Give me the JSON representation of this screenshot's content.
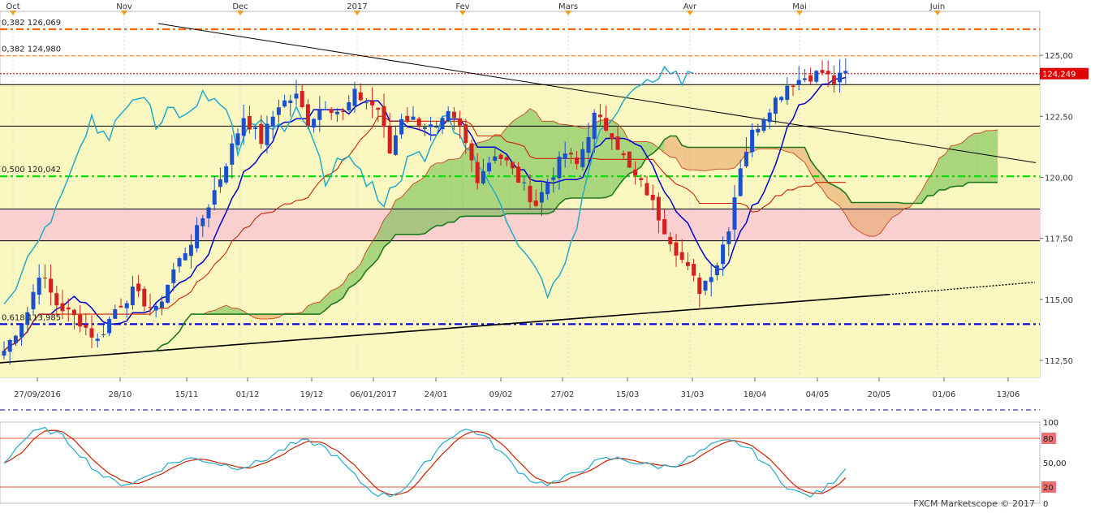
{
  "chart_data": {
    "type": "candlestick",
    "instrument_note": "",
    "months": [
      "Oct",
      "Nov",
      "Dec",
      "2017",
      "Fev",
      "Mars",
      "Avr",
      "Mai",
      "Juin"
    ],
    "date_ticks": [
      "27/09/2016",
      "28/10",
      "15/11",
      "01/12",
      "19/12",
      "06/01/2017",
      "24/01",
      "09/02",
      "27/02",
      "15/03",
      "31/03",
      "18/04",
      "04/05",
      "20/05",
      "01/06",
      "13/06"
    ],
    "price_axis": {
      "ticks": [
        "112,50",
        "115,00",
        "117,50",
        "120,00",
        "122,50",
        "125,00"
      ],
      "tick_values": [
        112.5,
        115,
        117.5,
        120,
        122.5,
        125
      ],
      "ylim": [
        111.8,
        126.8
      ]
    },
    "current_price_label": "124,249",
    "current_price": 124.249,
    "fib_labels": [
      {
        "text": "0,382 126,069",
        "value": 126.069
      },
      {
        "text": "0,382 124,980",
        "value": 124.98
      },
      {
        "text": "0,500 120,042",
        "value": 120.042
      },
      {
        "text": "0,618 113,985",
        "value": 113.985
      }
    ],
    "horizontal_levels": [
      {
        "value": 126.069,
        "style": "dash-dot",
        "color": "#ff6600"
      },
      {
        "value": 124.98,
        "style": "dashed-thin",
        "color": "#ff6600"
      },
      {
        "value": 124.249,
        "style": "dotted",
        "color": "#cc0000"
      },
      {
        "value": 123.8,
        "style": "solid",
        "color": "#000000"
      },
      {
        "value": 122.1,
        "style": "solid",
        "color": "#000000"
      },
      {
        "value": 120.042,
        "style": "dash-dot",
        "color": "#00dd00"
      },
      {
        "value": 118.7,
        "style": "solid",
        "color": "#000000"
      },
      {
        "value": 117.4,
        "style": "solid",
        "color": "#000000"
      },
      {
        "value": 113.985,
        "style": "dash-dot",
        "color": "#0000dd"
      }
    ],
    "oscillator": {
      "ticks": [
        "100",
        "80",
        "50,00",
        "20",
        "0"
      ],
      "tick_values": [
        100,
        80,
        50,
        20,
        0
      ],
      "levels": [
        80,
        20
      ]
    },
    "watermark": "FXCM Marketscope © 2017",
    "colors": {
      "up_candle": "#1a4fd0",
      "down_candle": "#d62020",
      "tenkan": "#0000cc",
      "kijun": "#cc2200",
      "chikou": "#22aacc",
      "senkou_b": "#1e7a1e",
      "cloud_bull": "#66bb44",
      "cloud_bear": "#e6a060",
      "band_yellow": "#fbf7c0",
      "band_pink": "#f9cfd0",
      "stoch_k": "#22aacc",
      "stoch_d": "#cc2200"
    }
  }
}
